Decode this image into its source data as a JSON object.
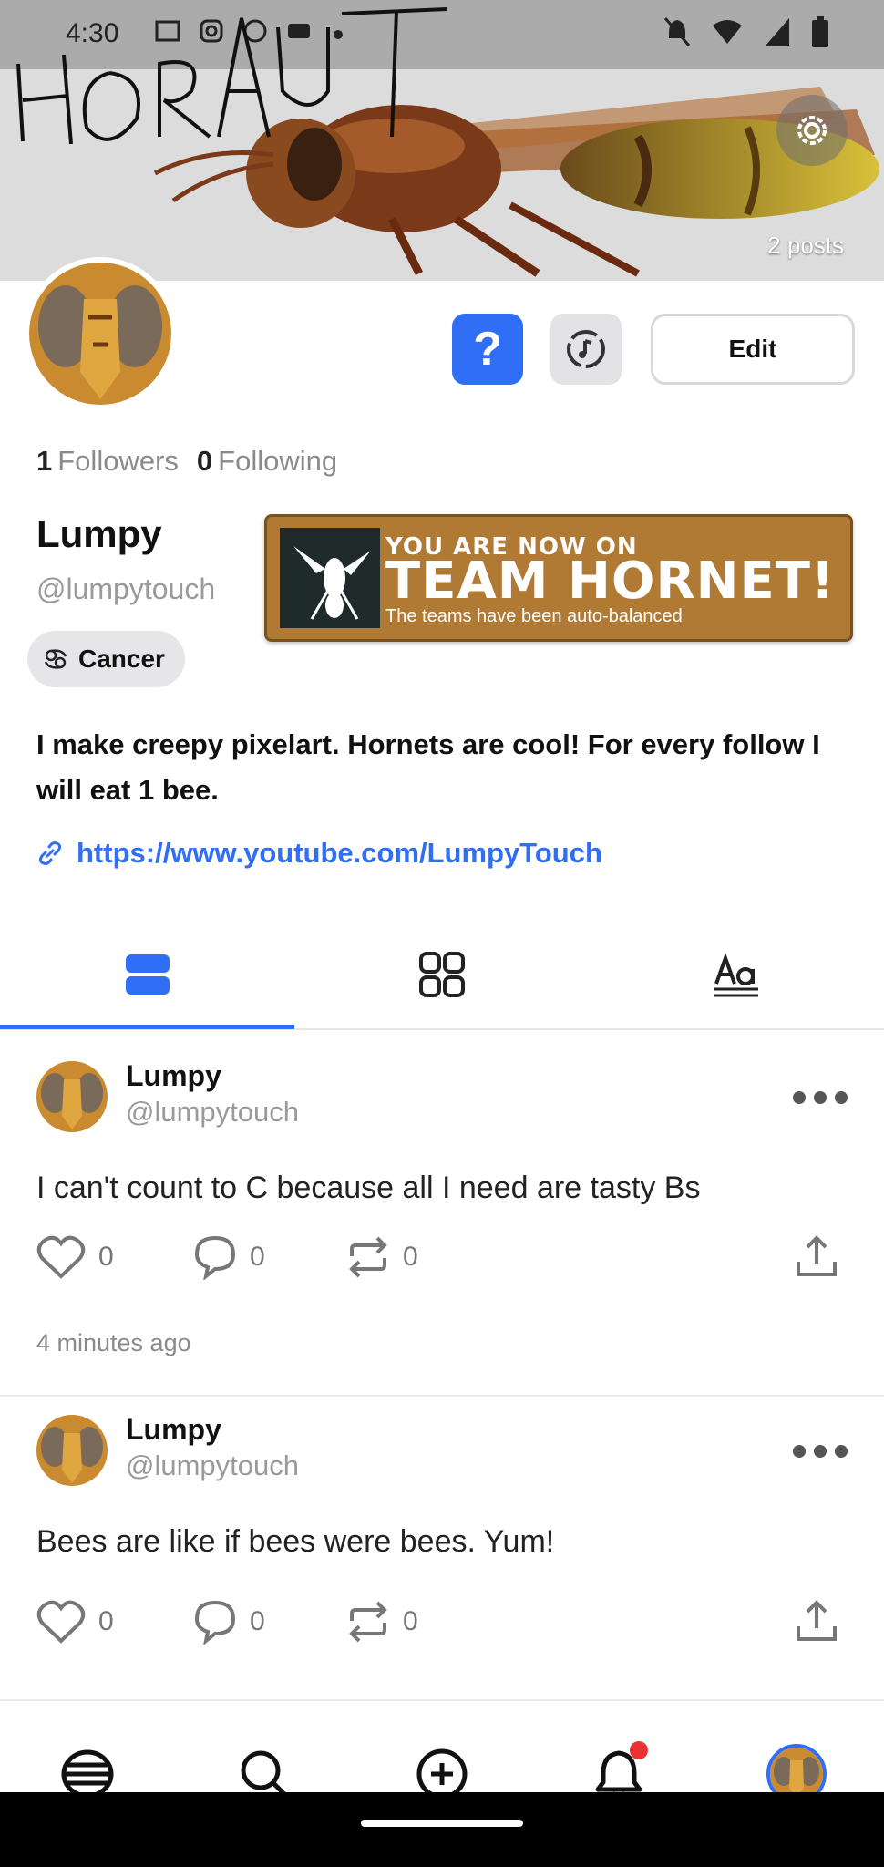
{
  "status_bar": {
    "time": "4:30"
  },
  "header": {
    "banner_scrawl": "HORNUT",
    "posts_count": "2 posts"
  },
  "profile": {
    "followers_count": "1",
    "followers_label": "Followers",
    "following_count": "0",
    "following_label": "Following",
    "display_name": "Lumpy",
    "handle": "@lumpytouch",
    "zodiac": "Cancer",
    "bio": "I make creepy pixelart. Hornets are cool! For every follow I will eat 1 bee.",
    "link": "https://www.youtube.com/LumpyTouch",
    "edit_label": "Edit",
    "question_label": "?"
  },
  "team_badge": {
    "line1": "YOU ARE NOW ON",
    "line2": "TEAM HORNET!",
    "line3": "The teams have been auto-balanced"
  },
  "tabs": [
    {
      "name": "posts-tab",
      "icon": "list-icon",
      "active": true
    },
    {
      "name": "media-tab",
      "icon": "grid-icon",
      "active": false
    },
    {
      "name": "text-tab",
      "icon": "text-style-icon",
      "active": false
    }
  ],
  "posts": [
    {
      "name": "Lumpy",
      "handle": "@lumpytouch",
      "text": "I can't count to C because all I need are tasty Bs",
      "likes": "0",
      "comments": "0",
      "reposts": "0",
      "time": "4 minutes ago"
    },
    {
      "name": "Lumpy",
      "handle": "@lumpytouch",
      "text": "Bees are like if bees were bees. Yum!",
      "likes": "0",
      "comments": "0",
      "reposts": "0"
    }
  ],
  "bottom_nav": [
    {
      "name": "home-nav",
      "icon": "hive-icon"
    },
    {
      "name": "search-nav",
      "icon": "search-icon"
    },
    {
      "name": "create-nav",
      "icon": "add-circle-icon"
    },
    {
      "name": "notifications-nav",
      "icon": "bell-icon",
      "has_badge": true
    },
    {
      "name": "profile-nav",
      "icon": "avatar"
    }
  ],
  "colors": {
    "accent": "#2f6ef5",
    "badge_brown": "#b07a34",
    "notification_red": "#ea3333"
  }
}
